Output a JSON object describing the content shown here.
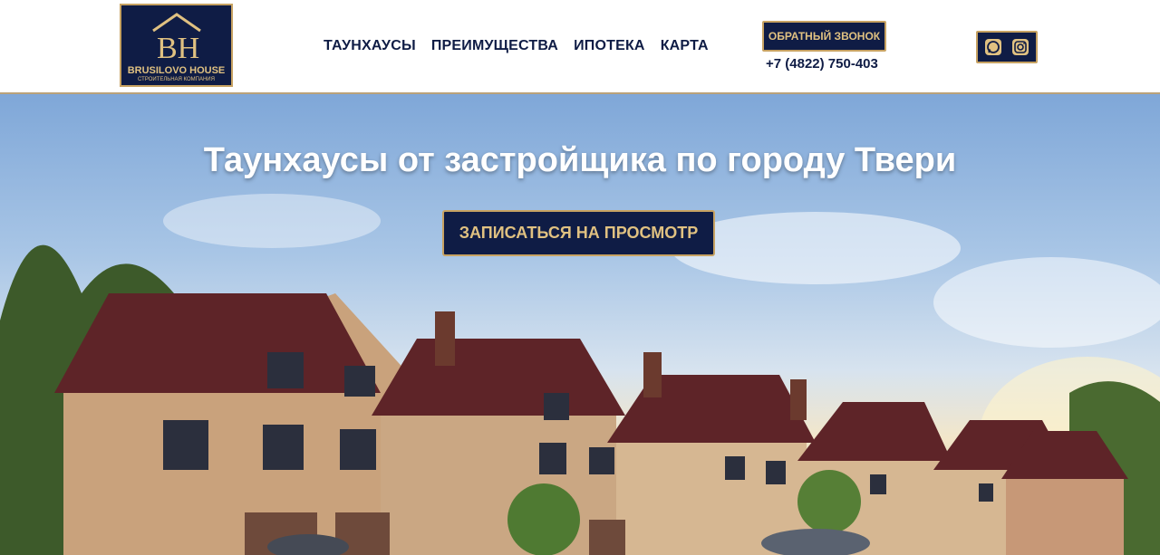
{
  "logo": {
    "title": "BRUSILOVO HOUSE",
    "subtitle": "СТРОИТЕЛЬНАЯ КОМПАНИЯ"
  },
  "nav": [
    {
      "label": "ТАУНХАУСЫ"
    },
    {
      "label": "ПРЕИМУЩЕСТВА"
    },
    {
      "label": "ИПОТЕКА"
    },
    {
      "label": "КАРТА"
    }
  ],
  "header": {
    "callback_label": "ОБРАТНЫЙ ЗВОНОК",
    "phone": "+7 (4822) 750-403"
  },
  "social": {
    "icons": [
      "whatsapp-icon",
      "instagram-icon"
    ]
  },
  "hero": {
    "title": "Таунхаусы от застройщика по городу Твери",
    "cta_label": "ЗАПИСАТЬСЯ НА ПРОСМОТР"
  },
  "colors": {
    "navy": "#0f1c45",
    "gold": "#c7a262",
    "gold_text": "#e0c181",
    "white": "#ffffff"
  }
}
